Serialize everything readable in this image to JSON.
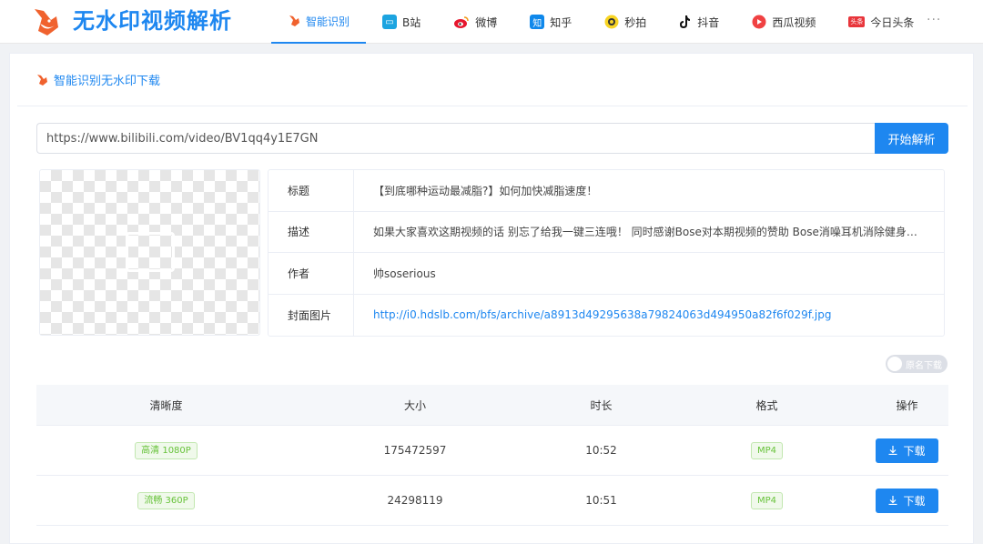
{
  "header": {
    "brand": "无水印视频解析",
    "nav": [
      {
        "label": "智能识别",
        "icon": "fox-icon"
      },
      {
        "label": "B站",
        "icon": "bilibili-icon"
      },
      {
        "label": "微博",
        "icon": "weibo-icon"
      },
      {
        "label": "知乎",
        "icon": "zhihu-icon"
      },
      {
        "label": "秒拍",
        "icon": "miaopai-icon"
      },
      {
        "label": "抖音",
        "icon": "douyin-icon"
      },
      {
        "label": "西瓜视频",
        "icon": "xigua-icon"
      },
      {
        "label": "今日头条",
        "icon": "toutiao-icon"
      }
    ],
    "more": "···"
  },
  "panel": {
    "title": "智能识别无水印下载"
  },
  "search": {
    "value": "https://www.bilibili.com/video/BV1qq4y1E7GN",
    "button": "开始解析"
  },
  "info": [
    {
      "label": "标题",
      "value": "【到底哪种运动最减脂?】如何加快减脂速度！"
    },
    {
      "label": "描述",
      "value": "如果大家喜欢这期视频的话 别忘了给我一键三连哦！ 同时感谢Bose对本期视频的赞助 Bose消噪耳机消除健身房..."
    },
    {
      "label": "作者",
      "value": "帅soserious"
    },
    {
      "label": "封面图片",
      "value": "http://i0.hdslb.com/bfs/archive/a8913d49295638a79824063d494950a82f6f029f.jpg"
    }
  ],
  "toggle": {
    "label": "原名下载"
  },
  "table": {
    "headers": [
      "清晰度",
      "大小",
      "时长",
      "格式",
      "操作"
    ],
    "rows": [
      {
        "quality": "高清 1080P",
        "size": "175472597",
        "duration": "10:52",
        "format": "MP4",
        "action": "下载"
      },
      {
        "quality": "流畅 360P",
        "size": "24298119",
        "duration": "10:51",
        "format": "MP4",
        "action": "下载"
      }
    ]
  },
  "colors": {
    "accent": "#1e87f0",
    "tag_green": "#67c23a"
  }
}
